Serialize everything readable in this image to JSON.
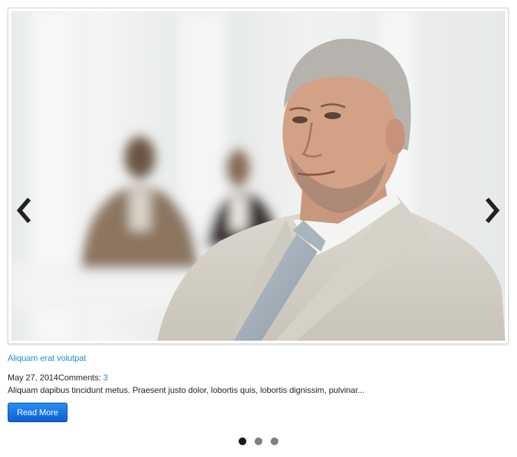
{
  "slide": {
    "caption": "Aliquam erat volutpat",
    "date": "May 27, 2014",
    "comments_label": "Comments: ",
    "comments_count": "3",
    "excerpt": "Aliquam dapibus tincidunt metus. Praesent justo dolor, lobortis quis, lobortis dignissim, pulvinar...",
    "read_more_label": "Read More"
  },
  "navigation": {
    "prev_icon": "chevron-left-icon",
    "next_icon": "chevron-right-icon",
    "dot_count": 3,
    "active_dot": 1
  },
  "colors": {
    "link": "#1a8bc9",
    "button": "#0c5fd4",
    "dot_active": "#1a1a1a",
    "dot_inactive": "#808080"
  }
}
